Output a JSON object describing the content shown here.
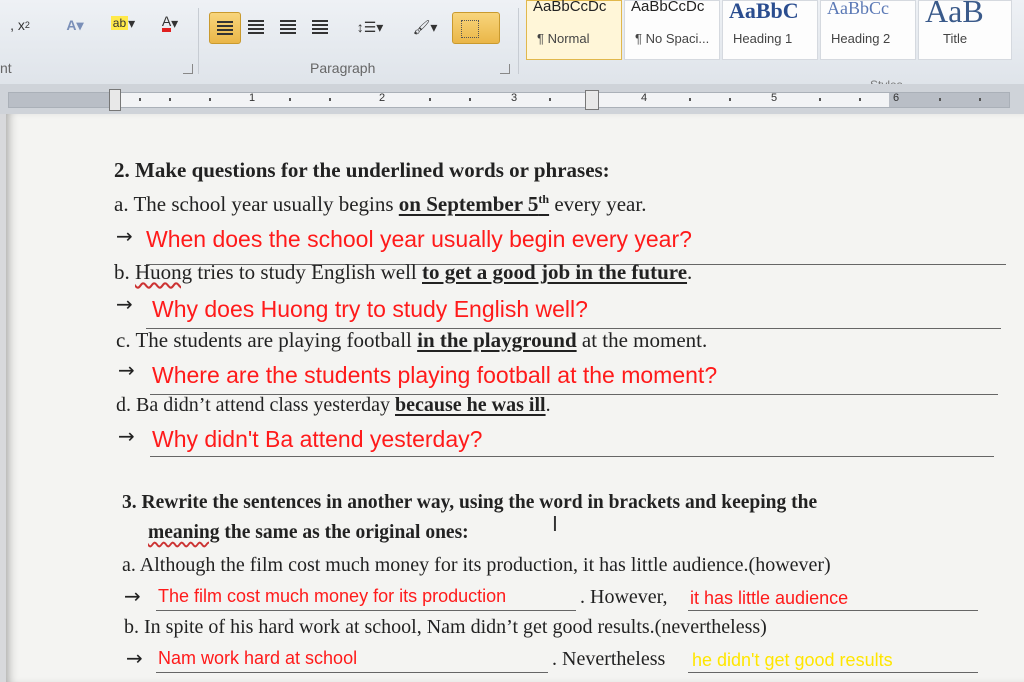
{
  "ribbon": {
    "font_group_label": "nt",
    "paragraph_group_label": "Paragraph",
    "styles_group_label": "Styles",
    "styles": [
      {
        "sample": "AaBbCcDc",
        "name": "¶ Normal"
      },
      {
        "sample": "AaBbCcDc",
        "name": "¶ No Spaci..."
      },
      {
        "sample": "AaBbC",
        "name": "Heading 1"
      },
      {
        "sample": "AaBbCc",
        "name": "Heading 2"
      },
      {
        "sample": "AaB",
        "name": "Title"
      }
    ]
  },
  "ruler": {
    "numbers": [
      "1",
      "2",
      "3",
      "4",
      "5",
      "6"
    ]
  },
  "doc": {
    "ex2": {
      "title": "2. Make questions for the underlined words or phrases:",
      "items": [
        {
          "pre": "a. The school year usually begins ",
          "ul": "on September 5",
          "sup": "th",
          "post": " every year.",
          "answer": "When does the school year usually begin every year?"
        },
        {
          "pre": "b. ",
          "squig": "Huong",
          "mid": " tries to study English well ",
          "ul": "to get a good job in the future",
          "post": ".",
          "answer": "Why does Huong try to study English well?"
        },
        {
          "pre": "c. The students are playing football ",
          "ul": "in the playground",
          "post": " at the moment.",
          "answer": "Where are the students playing football at the moment?"
        },
        {
          "pre": "d. Ba didn’t attend class yesterday ",
          "ul": "because he was ill",
          "post": ".",
          "answer": "Why didn't Ba attend yesterday?"
        }
      ]
    },
    "ex3": {
      "title1": "3. Rewrite the sentences in another way, using the word in brackets and keeping the",
      "title2a": "meaning",
      "title2b": " the same as the original ones:",
      "a": {
        "q": "a. Although the film cost much money for its production, it has little audience.(however)",
        "ans1": "The film cost much money for its production",
        "mid": ". However, ",
        "ans2": "it has little audience"
      },
      "b": {
        "q": "b. In spite of his hard work at school, Nam didn’t get good results.(nevertheless)",
        "ans1": "Nam work hard at school",
        "mid": ". Nevertheless ",
        "ans2": "he didn't get good results"
      }
    }
  },
  "colors": {
    "answer_red": "#ff1a1a",
    "answer_yellow": "#ffe600",
    "align_active": "#f4c95d"
  }
}
